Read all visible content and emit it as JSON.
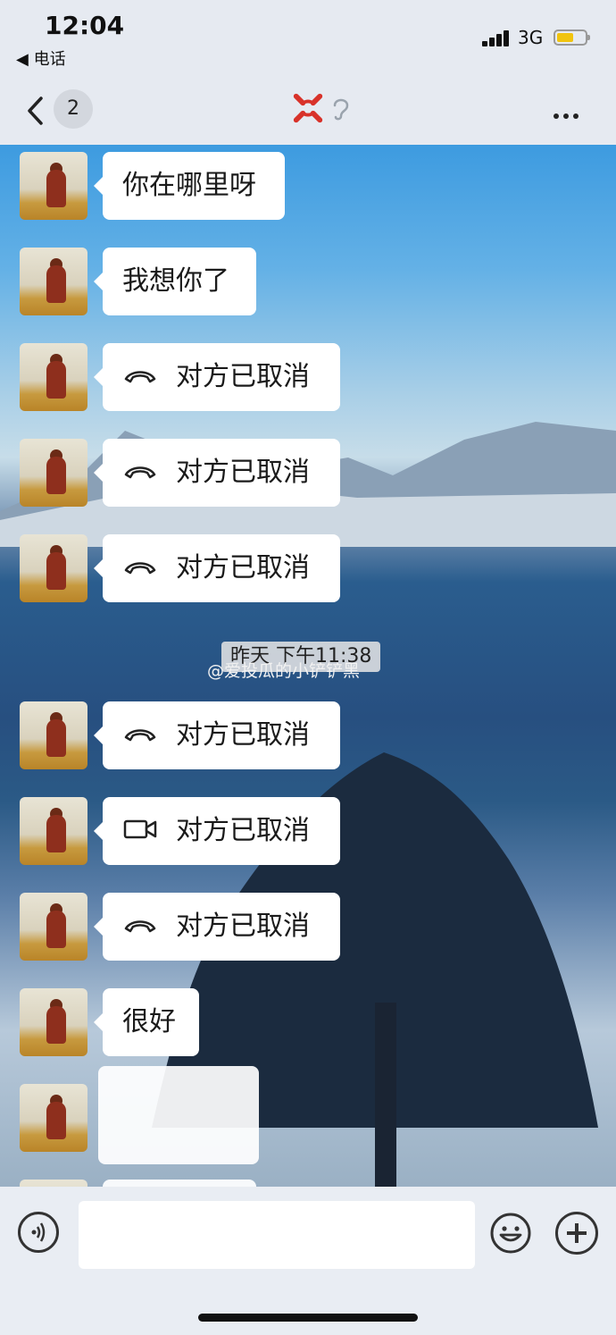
{
  "status_bar": {
    "time": "12:04",
    "back_app_label": "◀ 电话",
    "network": "3G",
    "battery_color": "#f1c40f"
  },
  "nav": {
    "unread_count": "2",
    "title_icon": "angry-face-icon",
    "mode_icon": "ear-icon"
  },
  "messages": [
    {
      "type": "text",
      "text": "你在哪里呀"
    },
    {
      "type": "text",
      "text": "我想你了"
    },
    {
      "type": "call",
      "icon": "phone-hangup-icon",
      "text": "对方已取消"
    },
    {
      "type": "call",
      "icon": "phone-hangup-icon",
      "text": "对方已取消"
    },
    {
      "type": "call",
      "icon": "phone-hangup-icon",
      "text": "对方已取消"
    },
    {
      "type": "call",
      "icon": "phone-hangup-icon",
      "text": "对方已取消"
    },
    {
      "type": "video",
      "icon": "video-camera-icon",
      "text": "对方已取消"
    },
    {
      "type": "call",
      "icon": "phone-hangup-icon",
      "text": "对方已取消"
    },
    {
      "type": "text",
      "text": "很好"
    }
  ],
  "timestamp": "昨天 下午11:38",
  "watermark": "@爱投瓜的小铲铲黑",
  "input": {
    "placeholder": ""
  }
}
